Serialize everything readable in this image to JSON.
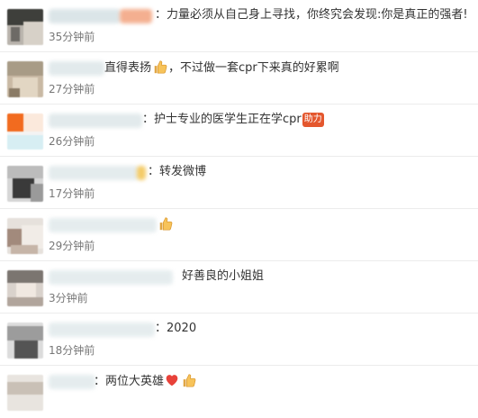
{
  "comments": [
    {
      "text": "：力量必须从自己身上寻找，你终究会发现:你是真正的强者!",
      "time": "35分钟前",
      "icons": []
    },
    {
      "text": "直得表扬",
      "text2": "，不过做一套cpr下来真的好累啊",
      "time": "27分钟前",
      "icons": [
        "thumbs-up-icon"
      ]
    },
    {
      "text": "护士专业的医学生正在学cpr",
      "badge": "助力",
      "time": "26分钟前",
      "icons": []
    },
    {
      "text": "转发微博",
      "time": "17分钟前",
      "icons": []
    },
    {
      "text": "",
      "time": "29分钟前",
      "icons": [
        "thumbs-up-icon"
      ]
    },
    {
      "text": "好善良的小姐姐",
      "time": "3分钟前",
      "icons": []
    },
    {
      "text": "：2020",
      "time": "18分钟前",
      "icons": []
    },
    {
      "text": "：两位大英雄",
      "time": "",
      "icons": [
        "heart-icon",
        "thumbs-up-icon"
      ]
    }
  ],
  "colors": {
    "text": "#333333",
    "time": "#777777",
    "divider": "#ececec",
    "badge": "#e4572e"
  }
}
